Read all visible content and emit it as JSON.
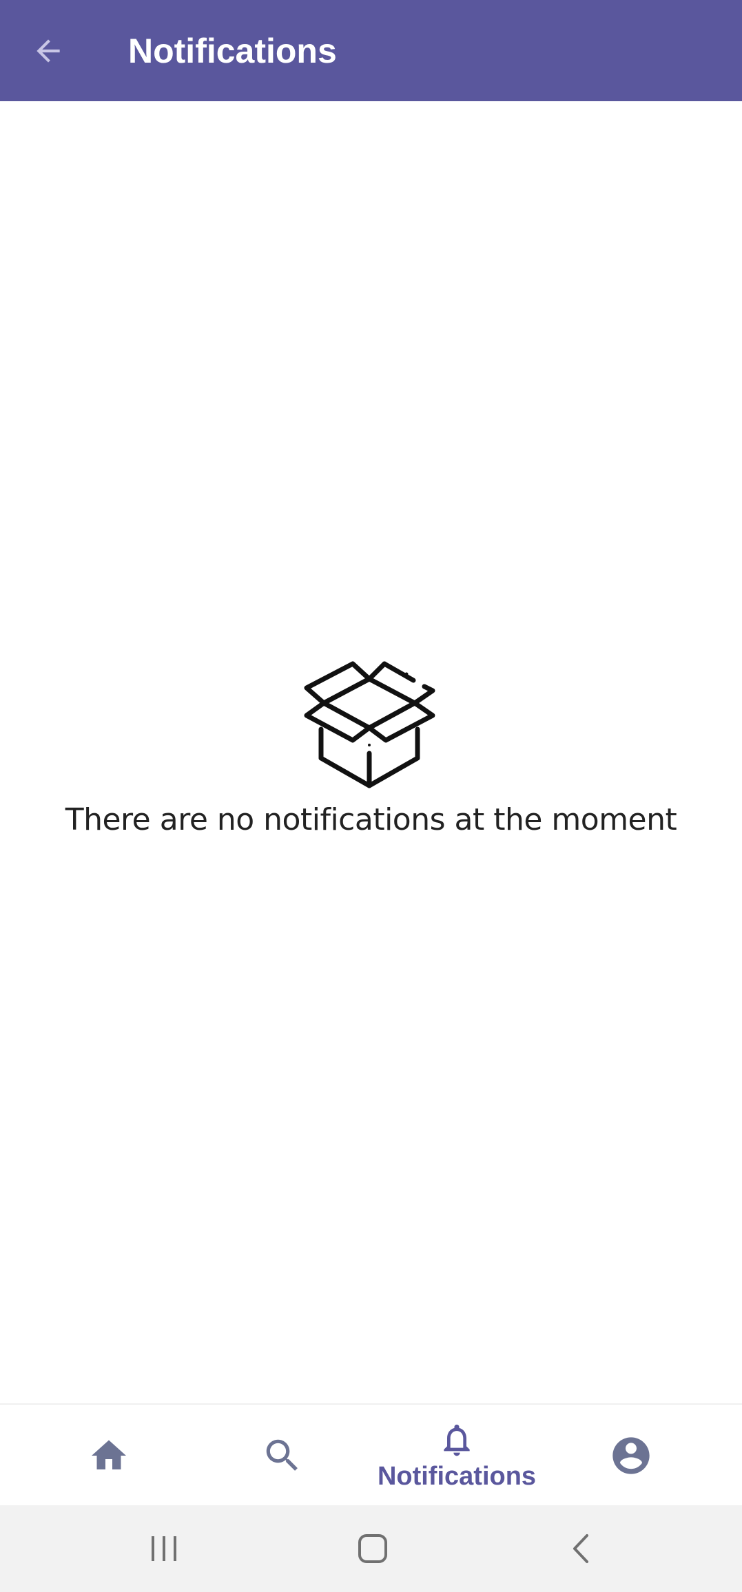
{
  "app_bar": {
    "title": "Notifications",
    "back_icon": "arrow-back-icon",
    "background_color": "#5a579d"
  },
  "empty_state": {
    "icon": "open-box-icon",
    "message": "There are no notifications at the moment"
  },
  "bottom_nav": {
    "items": [
      {
        "icon": "home-icon",
        "label": "",
        "active": false
      },
      {
        "icon": "search-icon",
        "label": "",
        "active": false
      },
      {
        "icon": "bell-icon",
        "label": "Notifications",
        "active": true
      },
      {
        "icon": "account-circle-icon",
        "label": "",
        "active": false
      }
    ],
    "active_color": "#5a579d",
    "inactive_color": "#6c7393"
  },
  "system_nav": {
    "items": [
      "recents-icon",
      "home-square-icon",
      "back-chevron-icon"
    ]
  }
}
